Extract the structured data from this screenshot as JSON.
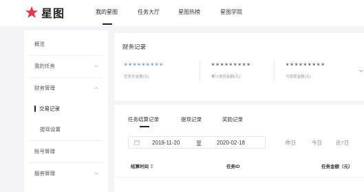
{
  "header": {
    "logo_text": "星图",
    "nav": [
      "我的星图",
      "任务大厅",
      "星图热榜",
      "星图学院"
    ]
  },
  "sidebar": {
    "items": [
      {
        "label": "概览"
      },
      {
        "label": "我的任务"
      },
      {
        "label": "财务管理"
      },
      {
        "label": "交易记录"
      },
      {
        "label": "提现设置"
      },
      {
        "label": "账号管理"
      },
      {
        "label": "服务管理"
      }
    ]
  },
  "finance": {
    "title": "财务记录",
    "stats": [
      {
        "value": "*********",
        "caption": "任务总金额(元)"
      },
      {
        "value": "*********",
        "caption": "累计提现金额(元)"
      },
      {
        "value": "*********",
        "caption": "可提现金额(元)"
      }
    ]
  },
  "records": {
    "tabs": [
      "任务结算记录",
      "提现记录",
      "奖励记录"
    ],
    "date_from": "2019-11-20",
    "date_sep": "至",
    "date_to": "2020-02-18",
    "quick_filters": [
      "昨日",
      "今日",
      "近7日"
    ],
    "columns": [
      "结算时间",
      "任务ID",
      "任务金额（元）"
    ]
  },
  "colors": {
    "logo_star": "#e8344e",
    "accent": "#3b7bd6"
  }
}
